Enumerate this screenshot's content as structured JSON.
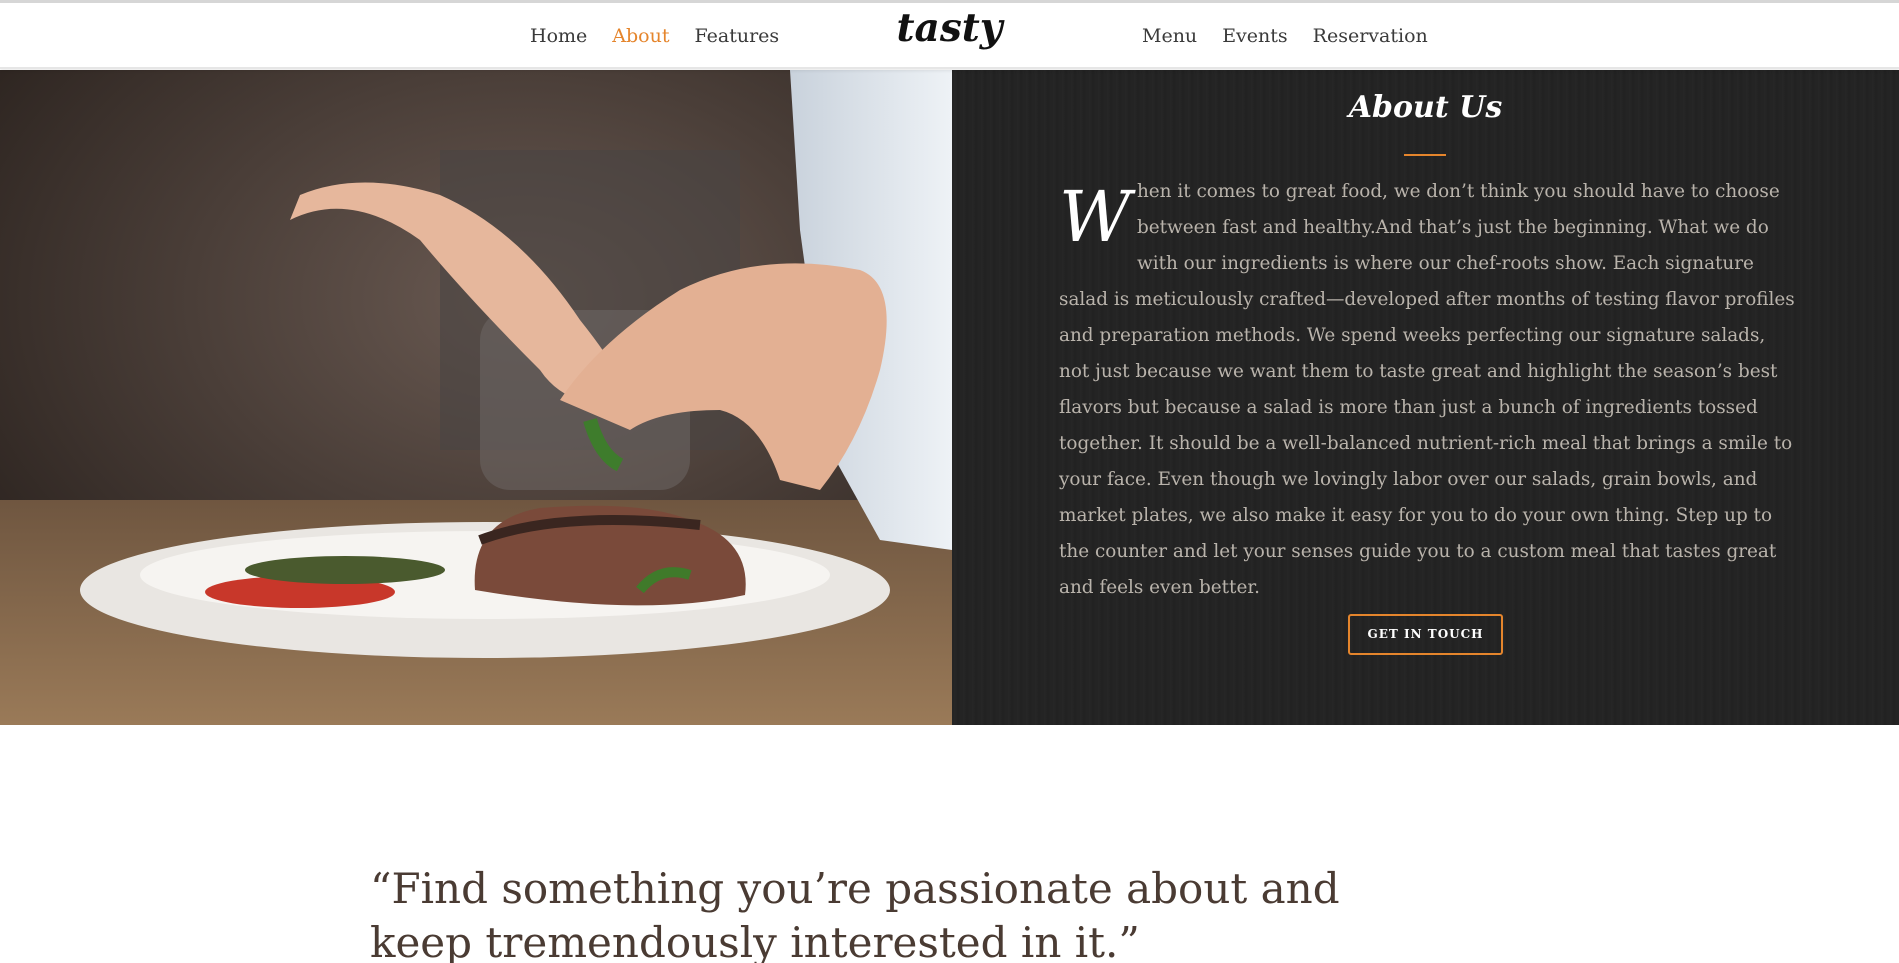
{
  "nav": {
    "left": [
      "Home",
      "About",
      "Features"
    ],
    "right": [
      "Menu",
      "Events",
      "Reservation"
    ],
    "active": "About",
    "logo": "tasty"
  },
  "about": {
    "title": "About Us",
    "dropcap": "W",
    "body": "hen it comes to great food, we don’t think you should have to choose between fast and healthy.And that’s just the beginning. What we do with our ingredients is where our chef-roots show. Each signature salad is meticulously crafted—developed after months of testing flavor profiles and preparation methods. We spend weeks perfecting our signature salads, not just because we want them to taste great and highlight the season’s best flavors but because a salad is more than just a bunch of ingredients tossed together. It should be a well-balanced nutrient-rich meal that brings a smile to your face. Even though we lovingly labor over our salads, grain bowls, and market plates, we also make it easy for you to do your own thing. Step up to the counter and let your senses guide you to a custom meal that tastes great and feels even better.",
    "button": "GET IN TOUCH"
  },
  "quote": {
    "text": "“Find something you’re passionate about and keep tremendously interested in it.”"
  },
  "colors": {
    "accent": "#e5852c",
    "panel_bg": "#232323",
    "text_muted": "#b9b3ab",
    "quote_text": "#4a3b33"
  }
}
